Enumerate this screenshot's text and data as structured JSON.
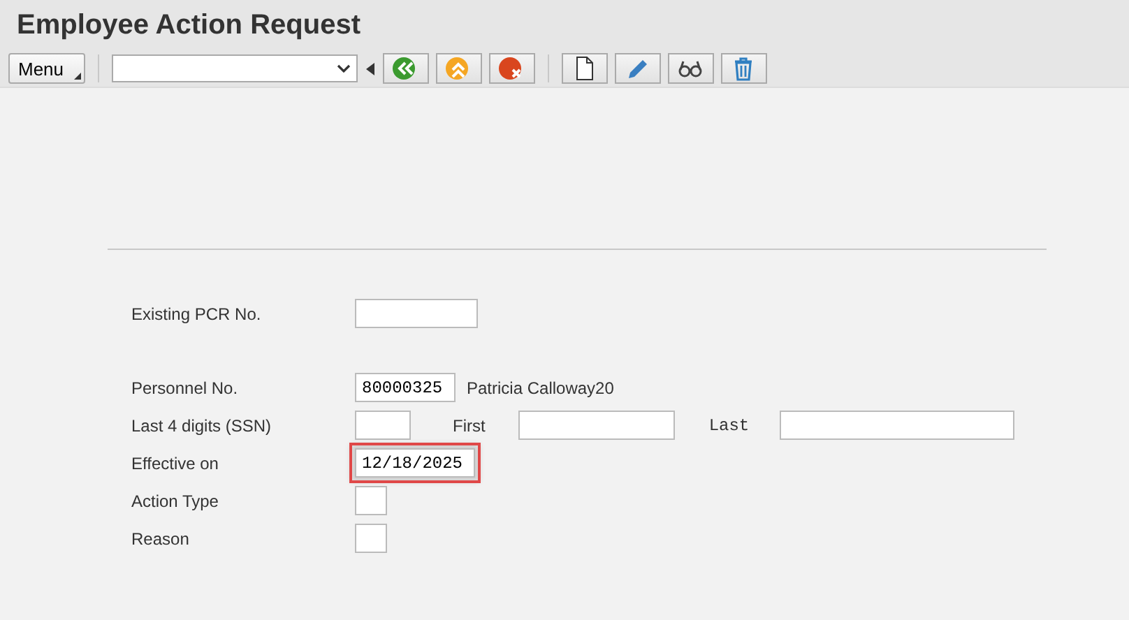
{
  "window": {
    "title": "Employee Action Request"
  },
  "toolbar": {
    "menu": "Menu"
  },
  "form": {
    "rows": [
      {
        "label": "Existing PCR No.",
        "highlighted": false
      },
      {
        "label": "Personnel No.",
        "value": "80000325",
        "note": "Patricia Calloway20",
        "highlighted": false
      },
      {
        "label": "Last 4 digits (SSN)",
        "highlighted": false,
        "extras": [
          {
            "label": "First"
          },
          {
            "label": "Last"
          }
        ]
      },
      {
        "label": "Effective on",
        "value": "12/18/2025",
        "highlighted": true
      },
      {
        "label": "Action Type",
        "highlighted": false
      },
      {
        "label": "Reason",
        "highlighted": false
      }
    ]
  }
}
